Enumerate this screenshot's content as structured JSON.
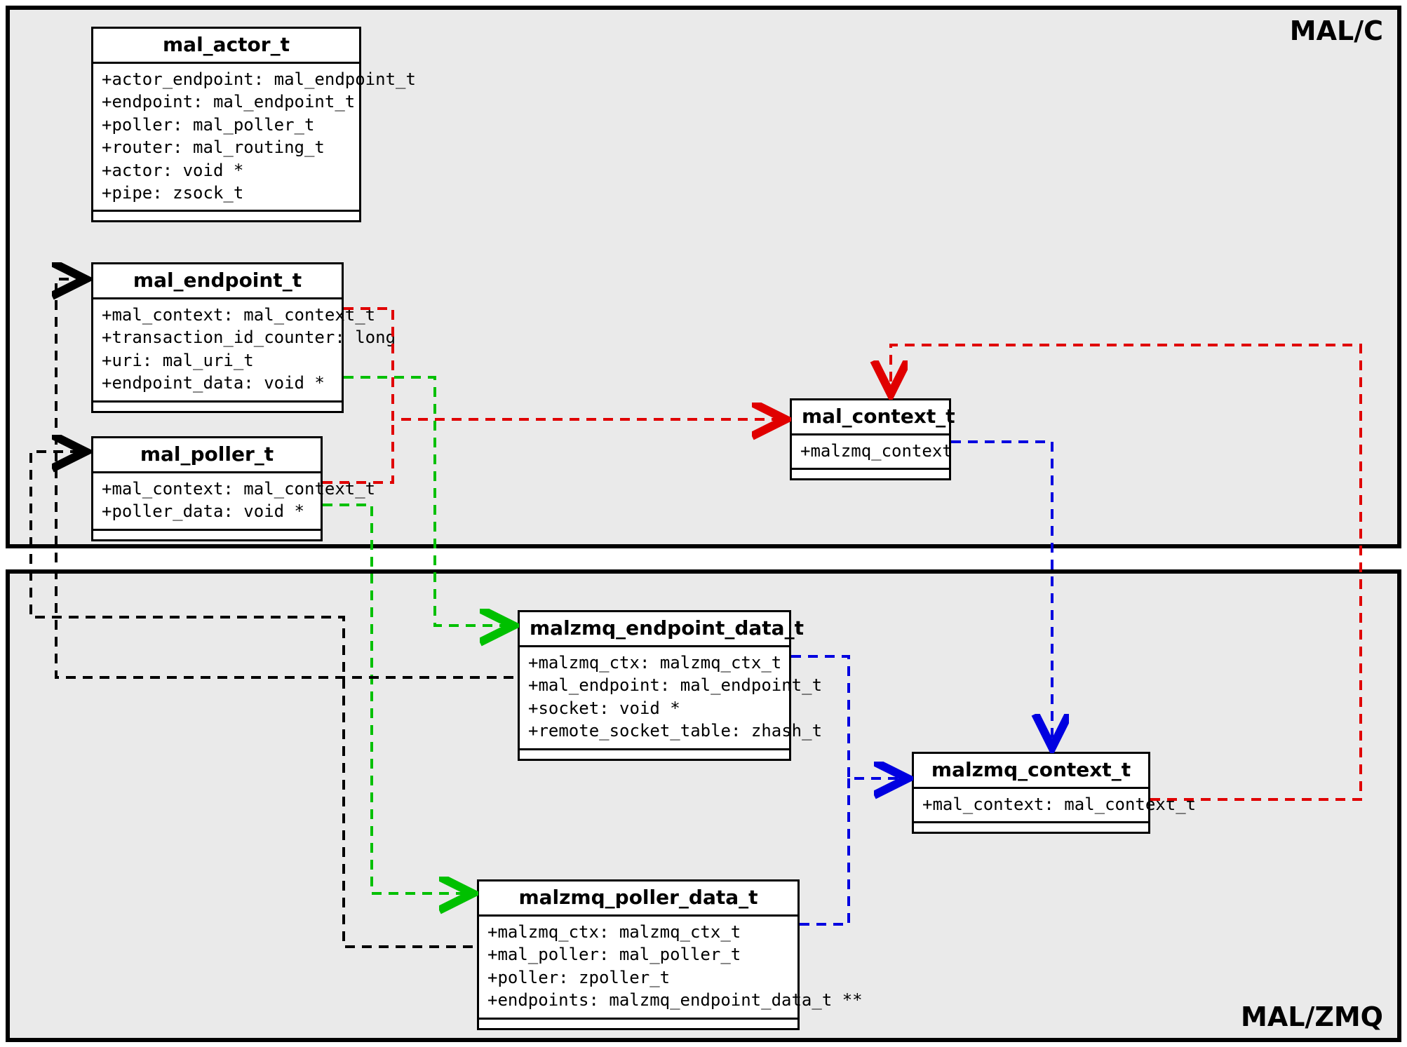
{
  "packages": {
    "top": {
      "label": "MAL/C"
    },
    "bottom": {
      "label": "MAL/ZMQ"
    }
  },
  "classes": {
    "mal_actor_t": {
      "name": "mal_actor_t",
      "attrs": [
        "+actor_endpoint: mal_endpoint_t",
        "+endpoint: mal_endpoint_t",
        "+poller: mal_poller_t",
        "+router: mal_routing_t",
        "+actor: void *",
        "+pipe: zsock_t"
      ]
    },
    "mal_endpoint_t": {
      "name": "mal_endpoint_t",
      "attrs": [
        "+mal_context: mal_context_t",
        "+transaction_id_counter: long",
        "+uri: mal_uri_t",
        "+endpoint_data: void *"
      ]
    },
    "mal_poller_t": {
      "name": "mal_poller_t",
      "attrs": [
        "+mal_context: mal_context_t",
        "+poller_data: void *"
      ]
    },
    "mal_context_t": {
      "name": "mal_context_t",
      "attrs": [
        "+malzmq_context"
      ]
    },
    "malzmq_endpoint_data_t": {
      "name": "malzmq_endpoint_data_t",
      "attrs": [
        "+malzmq_ctx: malzmq_ctx_t",
        "+mal_endpoint: mal_endpoint_t",
        "+socket: void *",
        "+remote_socket_table: zhash_t"
      ]
    },
    "malzmq_context_t": {
      "name": "malzmq_context_t",
      "attrs": [
        "+mal_context: mal_context_t"
      ]
    },
    "malzmq_poller_data_t": {
      "name": "malzmq_poller_data_t",
      "attrs": [
        "+malzmq_ctx: malzmq_ctx_t",
        "+mal_poller: mal_poller_t",
        "+poller: zpoller_t",
        "+endpoints: malzmq_endpoint_data_t **"
      ]
    }
  }
}
